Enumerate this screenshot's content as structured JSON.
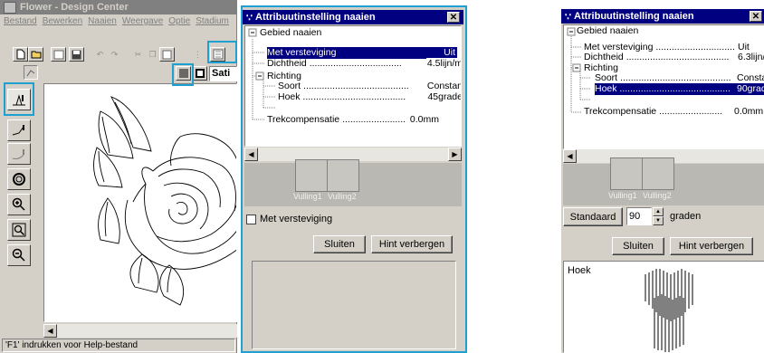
{
  "left_app": {
    "title": "Flower - Design Center",
    "menu": [
      "Bestand",
      "Bewerken",
      "Naaien",
      "Weergave",
      "Optie",
      "Stadium"
    ],
    "stitch_combo_value": "Sati",
    "status_text": "'F1' indrukken voor Help-bestand"
  },
  "dialog1": {
    "title": "Attribuutinstelling naaien",
    "tree": {
      "root": "Gebied naaien",
      "item1_label": "Met versteviging",
      "item1_value": "Uit",
      "item2_label": "Dichtheid",
      "item2_value": "4.5lijn/m",
      "group": "Richting",
      "item3_label": "Soort",
      "item3_value": "Constan",
      "item4_label": "Hoek",
      "item4_value": "45grade",
      "item5_label": "Trekcompensatie",
      "item5_value": "0.0mm"
    },
    "preview_labels": [
      "Vulling1",
      "Vulling2"
    ],
    "checkbox_label": "Met versteviging",
    "checkbox_checked": false,
    "close_label": "Sluiten",
    "hint_label": "Hint verbergen"
  },
  "dialog2": {
    "title": "Attribuutinstelling naaien",
    "tree": {
      "root": "Gebied naaien",
      "item1_label": "Met versteviging",
      "item1_value": "Uit",
      "item2_label": "Dichtheid",
      "item2_value": "6.3lijn/m",
      "group": "Richting",
      "item3_label": "Soort",
      "item3_value": "Consta",
      "item4_label": "Hoek",
      "item4_value": "90grad",
      "item5_label": "Trekcompensatie",
      "item5_value": "0.0mm"
    },
    "preview_labels": [
      "Vulling1",
      "Vulling2"
    ],
    "standard_label": "Standaard",
    "angle_value": "90",
    "angle_unit": "graden",
    "close_label": "Sluiten",
    "hint_label": "Hint verbergen",
    "hint_title": "Hoek"
  },
  "colors": {
    "titlebar": "#000080",
    "highlight_frame": "#1ea0d0",
    "face": "#d4d0c8"
  }
}
